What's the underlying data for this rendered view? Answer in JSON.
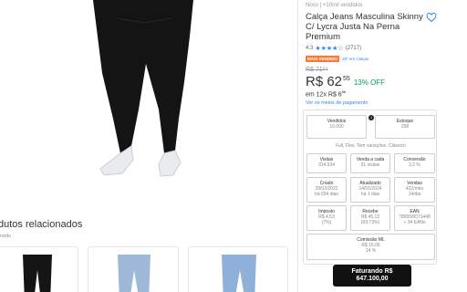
{
  "related": {
    "title": "dutos relacionados",
    "subtitle": "ncido"
  },
  "product": {
    "status": "Novo  |  +10mil vendidos",
    "title": "Calça Jeans Masculina Skinny C/ Lycra Justa Na Perna Premium",
    "rating_value": "4.3",
    "stars": "★★★★☆",
    "rating_count": "(2717)",
    "badge_label": "MAIS VENDIDO",
    "badge_category": "19º em Calças",
    "old_price": "R$ 71⁸⁹",
    "price_main": "R$ 62",
    "price_cents": "55",
    "discount": "13% OFF",
    "installments_prefix": "em 12x R$ 6",
    "installments_cents": "88",
    "payment_link": "Ver os meios de pagamento"
  },
  "metrics": {
    "sold_label": "Vendidos",
    "sold_value": "10.000",
    "stock_label": "Estoque",
    "stock_value": "258",
    "attributes": "Full, Flex, Tem variações, Clássico",
    "visits_label": "Visitas",
    "visits_value": "314.934",
    "sale_each_label": "Venda a cada",
    "sale_each_value": "31 visitas",
    "conversion_label": "Conversão",
    "conversion_value": "3,2 %",
    "created_label": "Criado",
    "created_date": "28/02/2022",
    "created_ago": "há 694 dias",
    "updated_label": "Atualizado",
    "updated_date": "14/01/2024",
    "updated_ago": "há 1 dias",
    "sales_label": "Vendas",
    "sales_value": "432/mês",
    "sales_daily": "14/dia",
    "tax_label": "Imposto",
    "tax_value": "R$ 4,53",
    "tax_pct": "(7%)",
    "receive_label": "Recebe",
    "receive_value": "R$ 45,12",
    "receive_pct": "(69,73%)",
    "ean_label": "EAN",
    "ean_value": "78955/6071448",
    "ean_extra": "+ 34 EANs",
    "commission_label": "Comissão ML",
    "commission_value": "R$ 15,06",
    "commission_pct": "14 %",
    "revenue_label": "Faturando R$",
    "revenue_value": "647.100,00"
  },
  "colors": {
    "accent_blue": "#3483fa",
    "badge_orange": "#ff7733",
    "discount_green": "#00a650",
    "button_black": "#111111"
  }
}
